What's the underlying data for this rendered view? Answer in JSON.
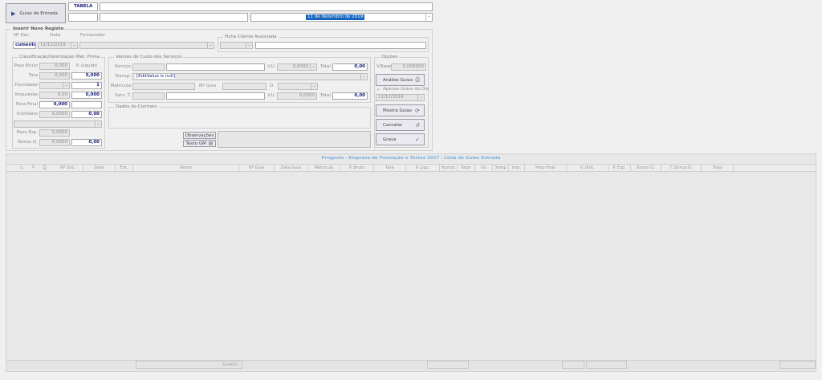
{
  "toolbar": {
    "guias_button": "Guias de Entrada",
    "tabela_label": "TABELA",
    "date_value": "11 de dezembro de 2019"
  },
  "inserir": {
    "title": "Inserir Novo Registo",
    "ndoc_label": "Nº Doc.",
    "data_label": "Data",
    "fornecedor_label": "Fornecedor",
    "ndoc_value": "cumento",
    "data_value": "11/12/2019",
    "ficha_label": "Ficha Cliente Associada"
  },
  "classificacao": {
    "title": "Classificação/Valorização Mat. Prima",
    "peso_bruto_label": "Peso Bruto",
    "peso_bruto_value": "0,000",
    "p_liquido_label": "P. Líquido",
    "tara_label": "Tara",
    "tara_value": "0,000",
    "tara_value2": "0,000",
    "humidade_label": "Humidade",
    "humidade_value": "1",
    "impurezas_label": "Impurezas",
    "impurezas_value": "0,00",
    "impurezas_value2": "0,000",
    "peso_final_label": "Peso Final",
    "peso_final_value": "0,000",
    "v_unitario_label": "V.Unitário",
    "v_unitario_value": "0,0000",
    "v_unitario_value2": "0,00",
    "peso_esp_label": "Peso Esp.",
    "peso_esp_value": "0,0000",
    "bonus_label": "Bonus Q.",
    "bonus_value": "0,0000",
    "bonus_value2": "0,00"
  },
  "valores": {
    "title": "Valores de Custo dos Serviços",
    "servico_label": "Serviço",
    "vu_label": "V.U",
    "vu_value": "0,0000",
    "total_label": "Total",
    "total_value": "0,00",
    "transp_label": "Transp.",
    "transp_value": "[EditValue is null]",
    "matricula_label": "Matrícula",
    "nguia_label": "Nº Guia",
    "d_label": "D.",
    "serv_t_label": "Serv. T.",
    "vu2_label": "V.U",
    "vu2_value": "0,0000",
    "total2_label": "Total",
    "total2_value": "0,00",
    "contrato_title": "Dados do Contrato",
    "observacoes_button": "Observações",
    "texto_gm_button": "Texto GM"
  },
  "opcoes": {
    "title": "Opções",
    "vbase_label": "V.Base",
    "vbase_value": "0,000000",
    "analise_button": "Análise Guias",
    "apenas_label": "Apenas Guias do Dia",
    "apenas_date": "11/12/2019",
    "mostra_button": "Mostra Guias",
    "cancelar_button": "Cancelar",
    "grava_button": "Grava"
  },
  "grid": {
    "title": "Progeste - Empresa de Formação e Testes 2017 - Lista de Guias Entrada",
    "columns": [
      "Nº Doc.",
      "Data",
      "Ent.",
      "Nome",
      "Nº Guia",
      "Data Guia",
      "Matrícula",
      "P. Bruto",
      "Tara",
      "P. Líqu.",
      "Humid.",
      "Fator",
      "Un",
      "%Imp",
      "Imp.",
      "Peso Final",
      "V. Unit.",
      "P. Esp.",
      "Bonus Q.",
      "T. Bonus Q.",
      "Total"
    ],
    "footer_guias": "Guia(s)"
  }
}
